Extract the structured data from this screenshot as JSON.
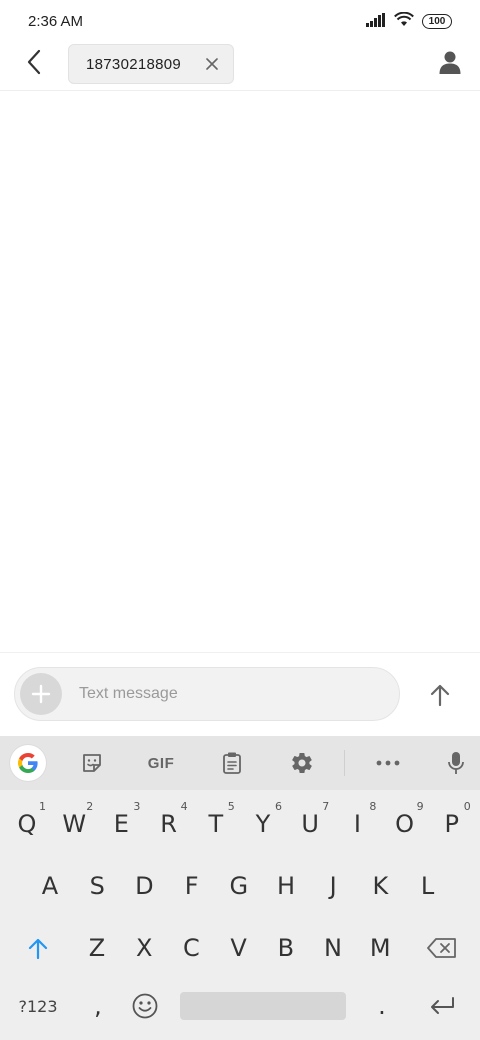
{
  "status_bar": {
    "time": "2:36 AM",
    "battery": "100",
    "icons": [
      "signal-icon",
      "wifi-icon",
      "battery-icon"
    ]
  },
  "header": {
    "recipient": "18730218809",
    "icons": [
      "back-arrow-icon",
      "close-icon",
      "contact-person-icon"
    ]
  },
  "compose": {
    "placeholder": "Text message",
    "value": "",
    "icons": [
      "plus-icon",
      "send-arrow-up-icon"
    ]
  },
  "keyboard_toolbar": {
    "gif_label": "GIF",
    "icons": [
      "google-g-icon",
      "sticker-icon",
      "clipboard-icon",
      "gear-icon",
      "more-dots-icon",
      "mic-icon"
    ]
  },
  "keyboard": {
    "row1": [
      {
        "key": "Q",
        "hint": "1"
      },
      {
        "key": "W",
        "hint": "2"
      },
      {
        "key": "E",
        "hint": "3"
      },
      {
        "key": "R",
        "hint": "4"
      },
      {
        "key": "T",
        "hint": "5"
      },
      {
        "key": "Y",
        "hint": "6"
      },
      {
        "key": "U",
        "hint": "7"
      },
      {
        "key": "I",
        "hint": "8"
      },
      {
        "key": "O",
        "hint": "9"
      },
      {
        "key": "P",
        "hint": "0"
      }
    ],
    "row2": [
      "A",
      "S",
      "D",
      "F",
      "G",
      "H",
      "J",
      "K",
      "L"
    ],
    "row3": [
      "Z",
      "X",
      "C",
      "V",
      "B",
      "N",
      "M"
    ],
    "row4": {
      "symbols": "?123",
      "comma": ",",
      "period": "."
    },
    "icons": [
      "shift-arrow-icon",
      "backspace-icon",
      "emoji-icon",
      "enter-return-icon"
    ],
    "accent_color": "#2196f3"
  }
}
